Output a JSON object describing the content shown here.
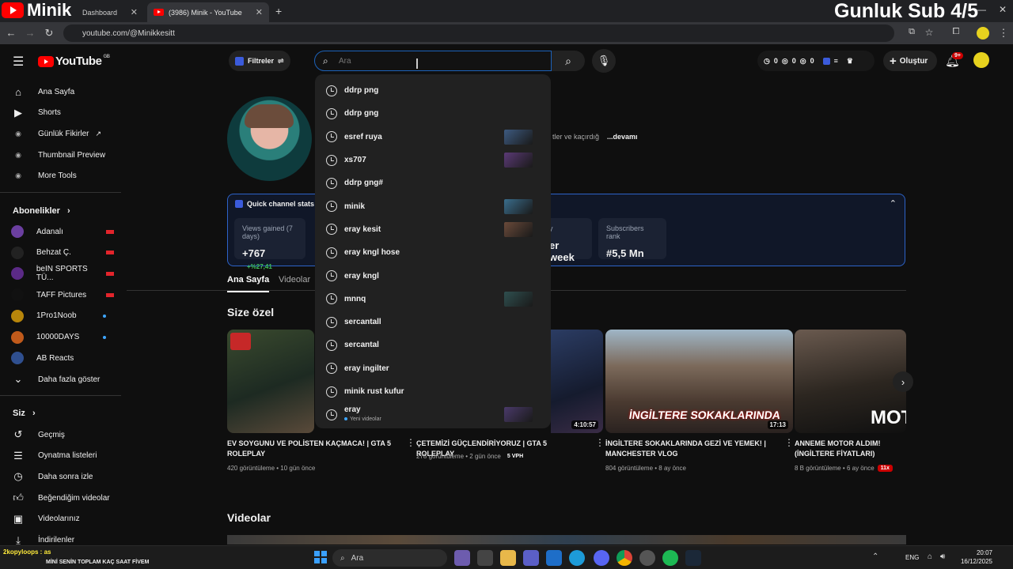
{
  "overlay": {
    "brand": "Minik",
    "stream_text": "Gunluk Sub 4/5"
  },
  "browser": {
    "tabs": [
      {
        "label": "Dashboard"
      },
      {
        "label": "(3986) Minik - YouTube"
      }
    ],
    "url": "youtube.com/@Minikkesitt"
  },
  "header": {
    "logo": "YouTube",
    "region": "GB",
    "filters_label": "Filtreler",
    "search_placeholder": "Ara",
    "counters": [
      "0",
      "0",
      "0"
    ],
    "create_label": "Oluştur",
    "notif_count": "9+"
  },
  "search_dropdown": {
    "suggestions": [
      {
        "text": "ddrp png",
        "thumb": false
      },
      {
        "text": "ddrp gng",
        "thumb": false
      },
      {
        "text": "esref ruya",
        "thumb": true
      },
      {
        "text": "xs707",
        "thumb": true
      },
      {
        "text": "ddrp gng#",
        "thumb": false
      },
      {
        "text": "minik",
        "thumb": true
      },
      {
        "text": "eray kesit",
        "thumb": true
      },
      {
        "text": "eray kngl hose",
        "thumb": false
      },
      {
        "text": "eray kngl",
        "thumb": false
      },
      {
        "text": "mnnq",
        "thumb": true
      },
      {
        "text": "sercantall",
        "thumb": false
      },
      {
        "text": "sercantal",
        "thumb": false
      },
      {
        "text": "eray ingilter",
        "thumb": false
      },
      {
        "text": "minik rust kufur",
        "thumb": false
      },
      {
        "text": "eray",
        "thumb": true,
        "sub": "Yeni videolar"
      }
    ]
  },
  "sidebar": {
    "main": [
      {
        "label": "Ana Sayfa",
        "icon": "home-icon"
      },
      {
        "label": "Shorts",
        "icon": "shorts-icon"
      },
      {
        "label": "Günlük Fikirler",
        "icon": "extension-icon"
      },
      {
        "label": "Thumbnail Preview",
        "icon": "extension-icon"
      },
      {
        "label": "More Tools",
        "icon": "extension-icon"
      }
    ],
    "subs_title": "Abonelikler",
    "subs": [
      {
        "label": "Adanalı",
        "color": "#6b3fa0",
        "mark": "flag"
      },
      {
        "label": "Behzat Ç.",
        "color": "#222222",
        "mark": "flag"
      },
      {
        "label": "beIN SPORTS TÜ...",
        "color": "#5b2a86",
        "mark": "flag"
      },
      {
        "label": "TAFF Pictures",
        "color": "#111111",
        "mark": "flag"
      },
      {
        "label": "1Pro1Noob",
        "color": "#b8860b",
        "mark": "dot"
      },
      {
        "label": "10000DAYS",
        "color": "#c05a1b",
        "mark": "dot"
      },
      {
        "label": "AB Reacts",
        "color": "#2f4f8f",
        "mark": "none"
      }
    ],
    "show_more": "Daha fazla göster",
    "you_title": "Siz",
    "you": [
      {
        "label": "Geçmiş",
        "icon": "history-icon"
      },
      {
        "label": "Oynatma listeleri",
        "icon": "playlist-icon"
      },
      {
        "label": "Daha sonra izle",
        "icon": "clock-icon"
      },
      {
        "label": "Beğendiğim videolar",
        "icon": "like-icon"
      },
      {
        "label": "Videolarınız",
        "icon": "video-icon"
      },
      {
        "label": "İndirilenler",
        "icon": "download-icon"
      }
    ]
  },
  "channel": {
    "desc_fragment": "tler ve kaçırdığ",
    "more_link": "...devamı",
    "stats_title": "Quick channel stats",
    "stats": [
      {
        "label": "Views gained (7 days)",
        "value": "+767",
        "delta": "+%27,41"
      },
      {
        "label": "",
        "value": "er week",
        "delta": ""
      },
      {
        "label": "Subscribers rank",
        "value": "#5,5 Mn",
        "delta": ""
      }
    ],
    "tabs": [
      "Ana Sayfa",
      "Videolar"
    ],
    "section_title": "Size özel",
    "videos_title": "Videolar"
  },
  "videos": [
    {
      "title": "EV SOYGUNU VE POLİSTEN KAÇMACA! | GTA 5 ROLEPLAY",
      "meta": "420 görüntüleme • 10 gün önce",
      "duration": "",
      "badge": ""
    },
    {
      "title": "ÇETEMİZİ GÜÇLENDİRİYORUZ | GTA 5 ROLEPLAY",
      "meta": "278 görüntüleme • 2 gün önce",
      "duration": "4:10:57",
      "badge": "5 VPH"
    },
    {
      "title": "İNGİLTERE SOKAKLARINDA GEZİ VE YEMEK! | MANCHESTER VLOG",
      "meta": "804 görüntüleme • 8 ay önce",
      "duration": "17:13",
      "badge": ""
    },
    {
      "title": "ANNEME MOTOR ALDIM! (İNGİLTERE FİYATLARI)",
      "meta": "8 B görüntüleme • 6 ay önce",
      "duration": "",
      "badge": "11x"
    }
  ],
  "taskbar": {
    "chat_user": "2kopyloops : as",
    "chat_text": "MİNİ SENİN TOPLAM KAÇ SAAT FİVEM",
    "search": "Ara",
    "lang": "ENG",
    "time": "20:07",
    "date": "16/12/2025"
  }
}
